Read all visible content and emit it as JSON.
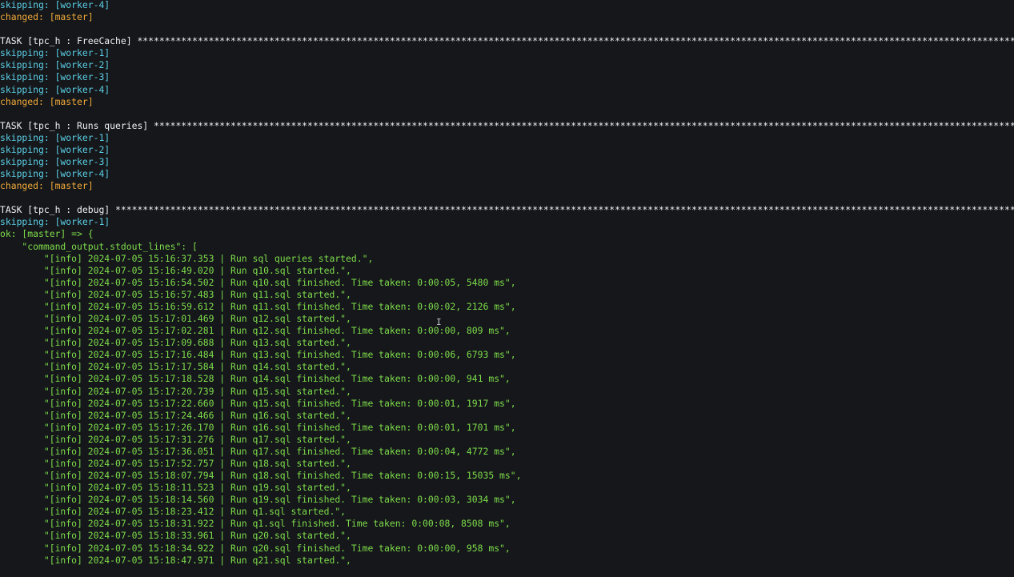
{
  "terminal": {
    "colors": {
      "background": "#15171a",
      "skipping": "#5ccfe6",
      "changed": "#f0a93a",
      "ok": "#7fdd4c",
      "task": "#eef1f4"
    },
    "lines": [
      {
        "kind": "skipping",
        "text": "skipping: [worker-4]"
      },
      {
        "kind": "changed",
        "text": "changed: [master]"
      },
      {
        "kind": "blank",
        "text": ""
      },
      {
        "kind": "task",
        "text": "TASK [tpc_h : FreeCache] *****************************************************************************************************************************************************************"
      },
      {
        "kind": "skipping",
        "text": "skipping: [worker-1]"
      },
      {
        "kind": "skipping",
        "text": "skipping: [worker-2]"
      },
      {
        "kind": "skipping",
        "text": "skipping: [worker-3]"
      },
      {
        "kind": "skipping",
        "text": "skipping: [worker-4]"
      },
      {
        "kind": "changed",
        "text": "changed: [master]"
      },
      {
        "kind": "blank",
        "text": ""
      },
      {
        "kind": "task",
        "text": "TASK [tpc_h : Runs queries] **************************************************************************************************************************************************************"
      },
      {
        "kind": "skipping",
        "text": "skipping: [worker-1]"
      },
      {
        "kind": "skipping",
        "text": "skipping: [worker-2]"
      },
      {
        "kind": "skipping",
        "text": "skipping: [worker-3]"
      },
      {
        "kind": "skipping",
        "text": "skipping: [worker-4]"
      },
      {
        "kind": "changed",
        "text": "changed: [master]"
      },
      {
        "kind": "blank",
        "text": ""
      },
      {
        "kind": "task",
        "text": "TASK [tpc_h : debug] *********************************************************************************************************************************************************************"
      },
      {
        "kind": "skipping",
        "text": "skipping: [worker-1]"
      },
      {
        "kind": "ok",
        "text": "ok: [master] => {"
      },
      {
        "kind": "ok",
        "text": "    \"command_output.stdout_lines\": ["
      },
      {
        "kind": "ok",
        "text": "        \"[info] 2024-07-05 15:16:37.353 | Run sql queries started.\","
      },
      {
        "kind": "ok",
        "text": "        \"[info] 2024-07-05 15:16:49.020 | Run q10.sql started.\","
      },
      {
        "kind": "ok",
        "text": "        \"[info] 2024-07-05 15:16:54.502 | Run q10.sql finished. Time taken: 0:00:05, 5480 ms\","
      },
      {
        "kind": "ok",
        "text": "        \"[info] 2024-07-05 15:16:57.483 | Run q11.sql started.\","
      },
      {
        "kind": "ok",
        "text": "        \"[info] 2024-07-05 15:16:59.612 | Run q11.sql finished. Time taken: 0:00:02, 2126 ms\","
      },
      {
        "kind": "ok",
        "text": "        \"[info] 2024-07-05 15:17:01.469 | Run q12.sql started.\","
      },
      {
        "kind": "ok",
        "text": "        \"[info] 2024-07-05 15:17:02.281 | Run q12.sql finished. Time taken: 0:00:00, 809 ms\","
      },
      {
        "kind": "ok",
        "text": "        \"[info] 2024-07-05 15:17:09.688 | Run q13.sql started.\","
      },
      {
        "kind": "ok",
        "text": "        \"[info] 2024-07-05 15:17:16.484 | Run q13.sql finished. Time taken: 0:00:06, 6793 ms\","
      },
      {
        "kind": "ok",
        "text": "        \"[info] 2024-07-05 15:17:17.584 | Run q14.sql started.\","
      },
      {
        "kind": "ok",
        "text": "        \"[info] 2024-07-05 15:17:18.528 | Run q14.sql finished. Time taken: 0:00:00, 941 ms\","
      },
      {
        "kind": "ok",
        "text": "        \"[info] 2024-07-05 15:17:20.739 | Run q15.sql started.\","
      },
      {
        "kind": "ok",
        "text": "        \"[info] 2024-07-05 15:17:22.660 | Run q15.sql finished. Time taken: 0:00:01, 1917 ms\","
      },
      {
        "kind": "ok",
        "text": "        \"[info] 2024-07-05 15:17:24.466 | Run q16.sql started.\","
      },
      {
        "kind": "ok",
        "text": "        \"[info] 2024-07-05 15:17:26.170 | Run q16.sql finished. Time taken: 0:00:01, 1701 ms\","
      },
      {
        "kind": "ok",
        "text": "        \"[info] 2024-07-05 15:17:31.276 | Run q17.sql started.\","
      },
      {
        "kind": "ok",
        "text": "        \"[info] 2024-07-05 15:17:36.051 | Run q17.sql finished. Time taken: 0:00:04, 4772 ms\","
      },
      {
        "kind": "ok",
        "text": "        \"[info] 2024-07-05 15:17:52.757 | Run q18.sql started.\","
      },
      {
        "kind": "ok",
        "text": "        \"[info] 2024-07-05 15:18:07.794 | Run q18.sql finished. Time taken: 0:00:15, 15035 ms\","
      },
      {
        "kind": "ok",
        "text": "        \"[info] 2024-07-05 15:18:11.523 | Run q19.sql started.\","
      },
      {
        "kind": "ok",
        "text": "        \"[info] 2024-07-05 15:18:14.560 | Run q19.sql finished. Time taken: 0:00:03, 3034 ms\","
      },
      {
        "kind": "ok",
        "text": "        \"[info] 2024-07-05 15:18:23.412 | Run q1.sql started.\","
      },
      {
        "kind": "ok",
        "text": "        \"[info] 2024-07-05 15:18:31.922 | Run q1.sql finished. Time taken: 0:00:08, 8508 ms\","
      },
      {
        "kind": "ok",
        "text": "        \"[info] 2024-07-05 15:18:33.961 | Run q20.sql started.\","
      },
      {
        "kind": "ok",
        "text": "        \"[info] 2024-07-05 15:18:34.922 | Run q20.sql finished. Time taken: 0:00:00, 958 ms\","
      },
      {
        "kind": "ok",
        "text": "        \"[info] 2024-07-05 15:18:47.971 | Run q21.sql started.\","
      }
    ]
  }
}
